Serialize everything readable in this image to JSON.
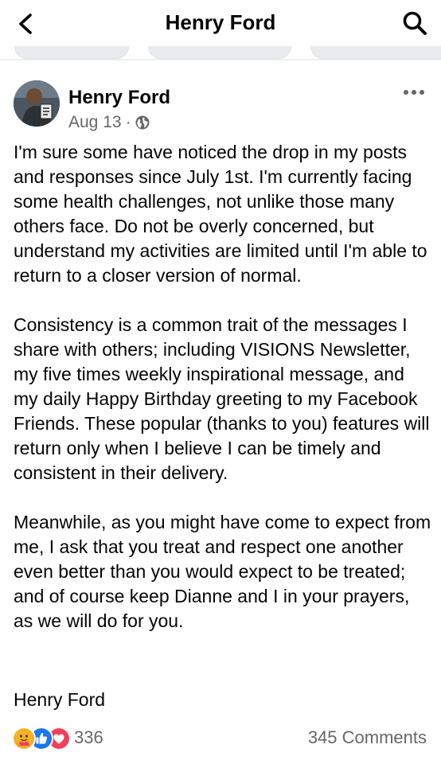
{
  "header": {
    "title": "Henry Ford",
    "back_icon": "chevron-left-icon",
    "search_icon": "search-icon"
  },
  "post": {
    "author": "Henry Ford",
    "date": "Aug 13",
    "separator": "·",
    "privacy_icon": "globe-icon",
    "more_icon": "more-horizontal-icon",
    "paragraphs": [
      "I'm sure some have noticed the drop in my posts and responses since July 1st.  I'm currently facing some health challenges, not unlike those many others face.  Do not be overly concerned, but understand my activities are limited until I'm able to return to a closer version of normal.",
      "Consistency is a common trait of the messages I share with others; including VISIONS Newsletter, my five times weekly inspirational message, and my daily Happy Birthday greeting to my Facebook Friends. These popular (thanks to you) features will return only when I believe I can be timely and consistent in their delivery.",
      "Meanwhile, as you might have come to expect from me, I ask that you treat and respect one another even better than you would expect to be treated; and of course keep Dianne and I in your prayers, as we will do for you."
    ],
    "signoff": "Henry Ford"
  },
  "footer": {
    "reaction_icons": [
      "care-icon",
      "like-icon",
      "love-icon"
    ],
    "reaction_count": "336",
    "comments": "345 Comments"
  },
  "colors": {
    "text": "#050505",
    "secondary": "#65676b",
    "like_blue": "#1877f2",
    "love_red": "#f33e58",
    "care_yellow": "#f7b125"
  }
}
